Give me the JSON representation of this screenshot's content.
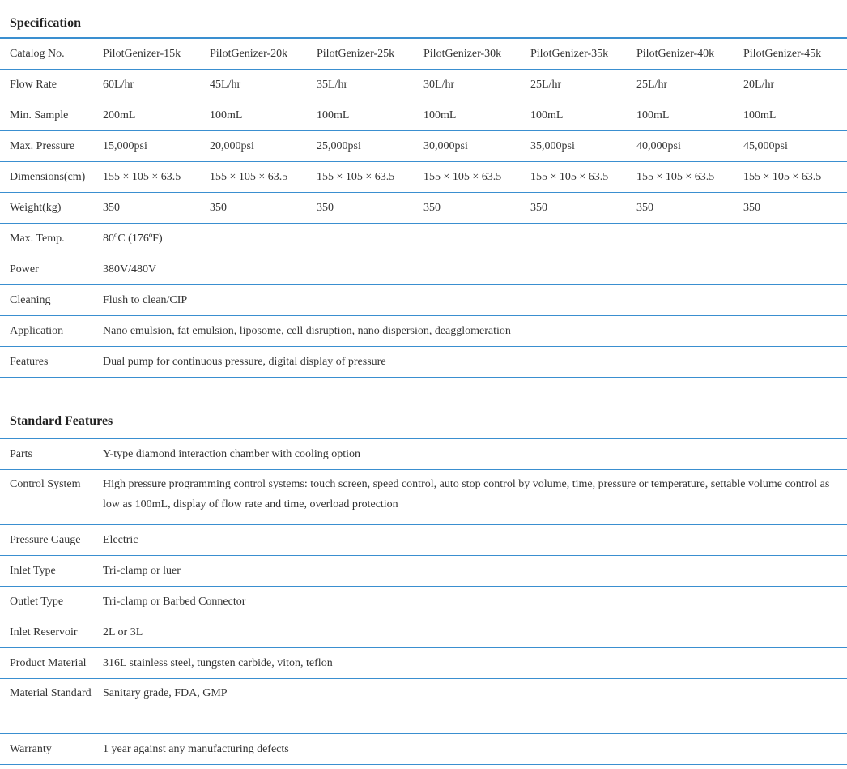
{
  "specification": {
    "title": "Specification",
    "model_rows": [
      {
        "label": "Catalog No.",
        "cells": [
          "PilotGenizer-15k",
          "PilotGenizer-20k",
          "PilotGenizer-25k",
          "PilotGenizer-30k",
          "PilotGenizer-35k",
          "PilotGenizer-40k",
          "PilotGenizer-45k"
        ]
      },
      {
        "label": "Flow Rate",
        "cells": [
          "60L/hr",
          "45L/hr",
          "35L/hr",
          "30L/hr",
          "25L/hr",
          "25L/hr",
          "20L/hr"
        ]
      },
      {
        "label": "Min. Sample",
        "cells": [
          "200mL",
          "100mL",
          "100mL",
          "100mL",
          "100mL",
          "100mL",
          "100mL"
        ]
      },
      {
        "label": "Max. Pressure",
        "cells": [
          "15,000psi",
          "20,000psi",
          "25,000psi",
          "30,000psi",
          "35,000psi",
          "40,000psi",
          "45,000psi"
        ]
      },
      {
        "label": "Dimensions(cm)",
        "cells": [
          "155 × 105 × 63.5",
          "155 × 105 × 63.5",
          "155 × 105 × 63.5",
          "155 × 105 × 63.5",
          "155 × 105 × 63.5",
          "155 × 105 × 63.5",
          "155 × 105 × 63.5"
        ]
      },
      {
        "label": "Weight(kg)",
        "cells": [
          "350",
          "350",
          "350",
          "350",
          "350",
          "350",
          "350"
        ]
      }
    ],
    "common_rows": [
      {
        "label": "Max. Temp.",
        "value": "80ºC (176ºF)"
      },
      {
        "label": "Power",
        "value": "380V/480V"
      },
      {
        "label": "Cleaning",
        "value": "Flush to clean/CIP"
      },
      {
        "label": "Application",
        "value": "Nano emulsion, fat emulsion, liposome, cell disruption, nano dispersion, deagglomeration"
      },
      {
        "label": "Features",
        "value": "Dual pump for continuous pressure, digital display of pressure"
      }
    ]
  },
  "standard_features": {
    "title": "Standard Features",
    "rows": [
      {
        "label": "Parts",
        "value": "Y-type diamond interaction chamber with cooling option"
      },
      {
        "label": "Control System",
        "value": "High pressure programming control systems: touch screen, speed control, auto stop control by volume, time, pressure or temperature, settable volume control as low as 100mL, display of flow rate and time, overload protection"
      },
      {
        "label": "Pressure Gauge",
        "value": "Electric"
      },
      {
        "label": "Inlet Type",
        "value": "Tri-clamp or luer"
      },
      {
        "label": "Outlet Type",
        "value": "Tri-clamp or Barbed Connector"
      },
      {
        "label": "Inlet Reservoir",
        "value": "2L or 3L"
      },
      {
        "label": "Product Material",
        "value": "316L stainless steel, tungsten carbide, viton, teflon"
      },
      {
        "label": "Material Standard",
        "value": "Sanitary grade, FDA, GMP"
      },
      {
        "label": "Warranty",
        "value": "1 year against any manufacturing defects"
      }
    ]
  }
}
